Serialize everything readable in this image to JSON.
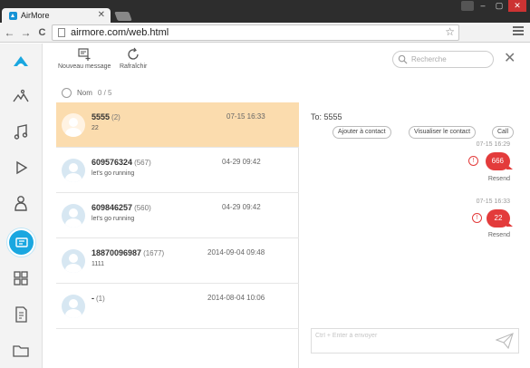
{
  "browser": {
    "tab_title": "AirMore",
    "tab_close": "✕",
    "url": "airmore.com/web.html",
    "back": "←",
    "forward": "→",
    "reload": "C",
    "star": "☆",
    "minimize": "–",
    "maximize": "▢",
    "close": "✕"
  },
  "toolbar": {
    "new_message_label": "Nouveau message",
    "refresh_label": "Rafraîchir",
    "search_placeholder": "Recherche",
    "close_symbol": "✕"
  },
  "list_header": {
    "name_label": "Nom",
    "selection_count": "0 / 5"
  },
  "conversations": [
    {
      "name": "5555",
      "count": "(2)",
      "date": "07-15 16:33",
      "preview": "22",
      "selected": true
    },
    {
      "name": "609576324",
      "count": "(567)",
      "date": "04-29 09:42",
      "preview": "let's go running",
      "selected": false
    },
    {
      "name": "609846257",
      "count": "(560)",
      "date": "04-29 09:42",
      "preview": "let's go running",
      "selected": false
    },
    {
      "name": "18870096987",
      "count": "(1677)",
      "date": "2014-09-04 09:48",
      "preview": "1111",
      "selected": false
    },
    {
      "name": "-",
      "count": "(1)",
      "date": "2014-08-04 10:06",
      "preview": "",
      "selected": false
    }
  ],
  "thread": {
    "to_label": "To: 5555",
    "add_contact": "Ajouter à contact",
    "view_contact": "Visualiser le contact",
    "call": "Call",
    "messages": [
      {
        "time": "07-15 16:29",
        "text": "666",
        "status": "Resend",
        "warn": "!"
      },
      {
        "time": "07-15 16:33",
        "text": "22",
        "status": "Resend",
        "warn": "!"
      }
    ],
    "compose_placeholder": "Ctrl + Enter à envoyer"
  },
  "colors": {
    "accent": "#1aa7e0",
    "selected_row": "#fbdcae",
    "bubble": "#e33b3b"
  },
  "rail_icons": [
    "airmore-logo-icon",
    "photos-icon",
    "music-icon",
    "videos-icon",
    "contacts-icon",
    "messages-icon",
    "apps-icon",
    "documents-icon",
    "files-icon"
  ]
}
